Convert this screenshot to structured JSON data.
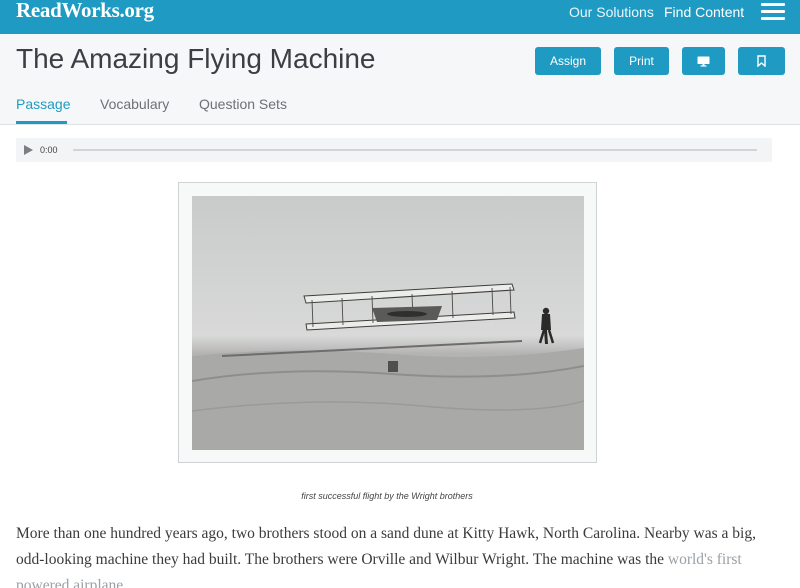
{
  "header": {
    "logo": "ReadWorks.org",
    "nav": [
      {
        "label": "Our Solutions"
      },
      {
        "label": "Find Content"
      }
    ]
  },
  "page": {
    "title": "The Amazing Flying Machine",
    "actions": {
      "assign": "Assign",
      "print": "Print"
    },
    "tabs": [
      {
        "label": "Passage",
        "active": true
      },
      {
        "label": "Vocabulary"
      },
      {
        "label": "Question Sets"
      }
    ]
  },
  "audio": {
    "time": "0:00"
  },
  "figure": {
    "caption": "first successful flight by the Wright brothers"
  },
  "passage": {
    "text_main": "More than one hundred years ago, two brothers stood on a sand dune at Kitty Hawk, North Carolina. Nearby was a big, odd-looking machine they had built. The brothers were Orville and Wilbur Wright. The machine was the",
    "text_faded": "world's first powered airplane."
  },
  "colors": {
    "brand": "#1f9bc3",
    "title_bar": "#f6f7f8"
  },
  "icons": [
    "hamburger-menu-icon",
    "monitor-icon",
    "bookmark-icon",
    "play-icon"
  ]
}
